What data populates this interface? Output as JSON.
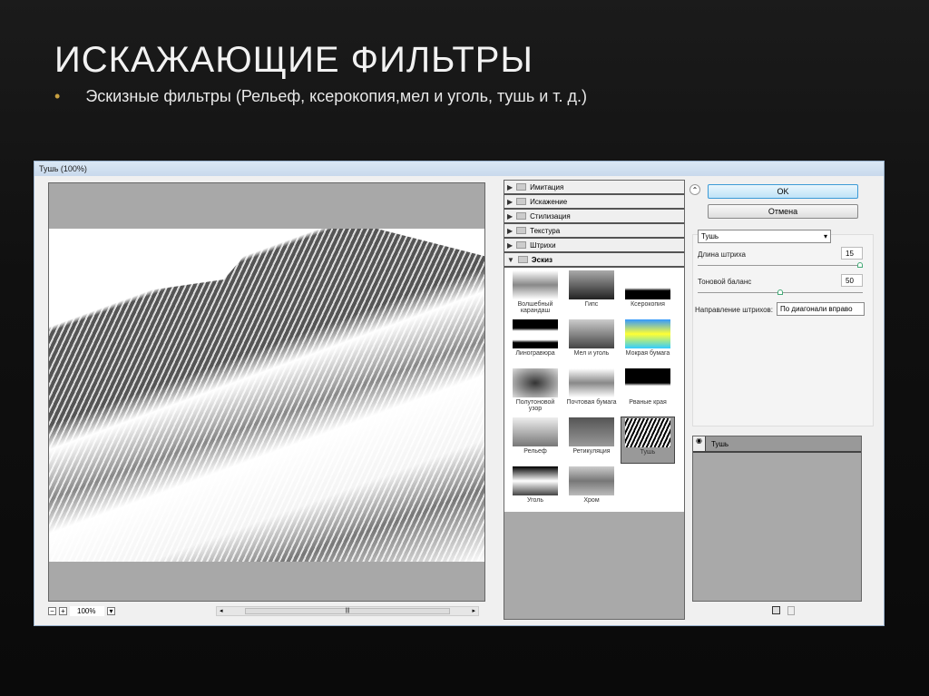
{
  "slide": {
    "title": "ИСКАЖАЮЩИЕ ФИЛЬТРЫ",
    "bullet": "Эскизные фильтры (Рельеф, ксерокопия,мел и уголь, тушь и т. д.)",
    "bullet_mark": "•"
  },
  "window": {
    "title": "Тушь (100%)"
  },
  "preview": {
    "zoom": "100%",
    "minus": "−",
    "plus": "+"
  },
  "categories": [
    {
      "label": "Имитация",
      "icon": "▶"
    },
    {
      "label": "Искажение",
      "icon": "▶"
    },
    {
      "label": "Стилизация",
      "icon": "▶"
    },
    {
      "label": "Текстура",
      "icon": "▶"
    },
    {
      "label": "Штрихи",
      "icon": "▶"
    },
    {
      "label": "Эскиз",
      "icon": "▼"
    }
  ],
  "filters": [
    "Волшебный карандаш",
    "Гипс",
    "Ксерокопия",
    "Линогравюра",
    "Мел и уголь",
    "Мокрая бумага",
    "Полутоновой узор",
    "Почтовая бумага",
    "Рваные края",
    "Рельеф",
    "Ретикуляция",
    "Тушь",
    "Уголь",
    "Хром"
  ],
  "selected_filter": "Тушь",
  "buttons": {
    "ok": "OK",
    "cancel": "Отмена",
    "collapse": "⌃"
  },
  "params": {
    "filter_select": "Тушь",
    "stroke_length_label": "Длина штриха",
    "stroke_length": "15",
    "stroke_length_fraction": 1.0,
    "tone_label": "Тоновой баланс",
    "tone": "50",
    "tone_fraction": 0.5,
    "direction_label": "Направление штрихов:",
    "direction": "По диагонали вправо"
  },
  "layers": [
    {
      "name": "Тушь"
    }
  ]
}
